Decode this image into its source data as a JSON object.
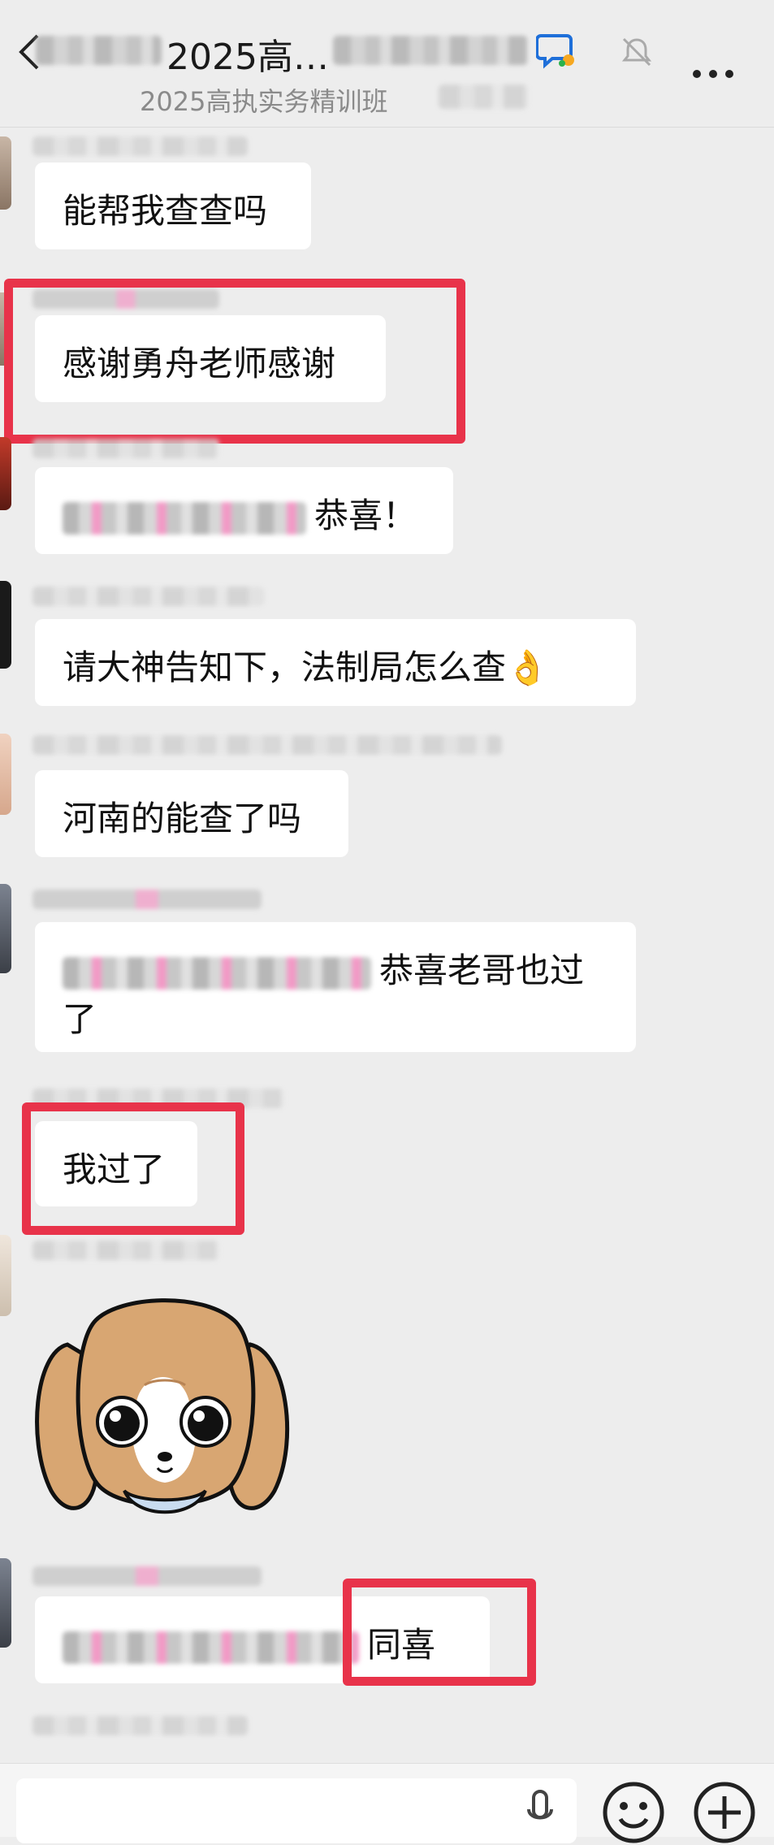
{
  "header": {
    "title": "2025高…",
    "subtitle": "2025高执实务精训班",
    "more_label": "…"
  },
  "messages": [
    {
      "text": "能帮我查查吗"
    },
    {
      "text": "感谢勇舟老师感谢"
    },
    {
      "text": "恭喜！"
    },
    {
      "text": "请大神告知下，法制局怎么查👌"
    },
    {
      "text": "河南的能查了吗"
    },
    {
      "text": "恭喜老哥也过了"
    },
    {
      "text": "我过了"
    },
    {
      "sticker": "puppy-sticker"
    },
    {
      "text": "同喜"
    }
  ],
  "icons": {
    "back": "back-arrow-icon",
    "group_chat": "group-chat-icon",
    "mute": "muted-bell-icon",
    "more": "more-options-icon",
    "voice": "microphone-icon",
    "emoji": "emoji-icon",
    "add": "add-icon"
  },
  "colors": {
    "background": "#ededed",
    "bubble": "#ffffff",
    "highlight": "#e8334a"
  }
}
